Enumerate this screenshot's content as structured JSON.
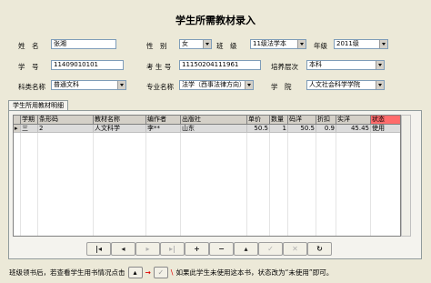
{
  "title": "学生所需教材录入",
  "form": {
    "name_label": "姓　名",
    "name_value": "张湘",
    "gender_label": "性　别",
    "gender_value": "女",
    "class_label": "班　级",
    "class_value": "11级法学本",
    "grade_label": "年级",
    "grade_value": "2011级",
    "id_label": "学　号",
    "id_value": "11409010101",
    "exam_label": "考 生 号",
    "exam_value": "11150204111961",
    "level_label": "培养层次",
    "level_value": "本科",
    "category_label": "科类名称",
    "category_value": "普通文科",
    "major_label": "专业名称",
    "major_value": "法学（西事法律方向）",
    "school_label": "学　院",
    "school_value": "人文社会科学学院"
  },
  "tab_label": "学生所用教材明细",
  "grid": {
    "headers": [
      "学期",
      "条形码",
      "教材名称",
      "编作者",
      "出版社",
      "单价",
      "数量",
      "码洋",
      "折扣",
      "实洋",
      "状态"
    ],
    "rows": [
      [
        "三",
        "2",
        "人文科学",
        "李**",
        "山东",
        "50.5",
        "1",
        "50.5",
        "0.9",
        "45.45",
        "使用"
      ]
    ]
  },
  "nav_buttons": [
    {
      "icon": "first-record-icon",
      "glyph": "|◂",
      "enabled": true
    },
    {
      "icon": "prev-record-icon",
      "glyph": "◂",
      "enabled": true
    },
    {
      "icon": "next-record-icon",
      "glyph": "▸",
      "enabled": false
    },
    {
      "icon": "last-record-icon",
      "glyph": "▸|",
      "enabled": false
    },
    {
      "icon": "insert-record-icon",
      "glyph": "+",
      "enabled": true
    },
    {
      "icon": "delete-record-icon",
      "glyph": "−",
      "enabled": true
    },
    {
      "icon": "edit-record-icon",
      "glyph": "▴",
      "enabled": true
    },
    {
      "icon": "post-edit-icon",
      "glyph": "✓",
      "enabled": false
    },
    {
      "icon": "cancel-edit-icon",
      "glyph": "✕",
      "enabled": false
    },
    {
      "icon": "refresh-icon",
      "glyph": "↻",
      "enabled": true
    }
  ],
  "bottom": {
    "text1": "班级领书后，若查看学生用书情况点击",
    "arrow": "→",
    "text2": "如果此学生未使用这本书，状态改为“未使用”即可。"
  },
  "colors": {
    "status_header": "#ff6b6b",
    "row_selected": "#dcdcdc"
  }
}
